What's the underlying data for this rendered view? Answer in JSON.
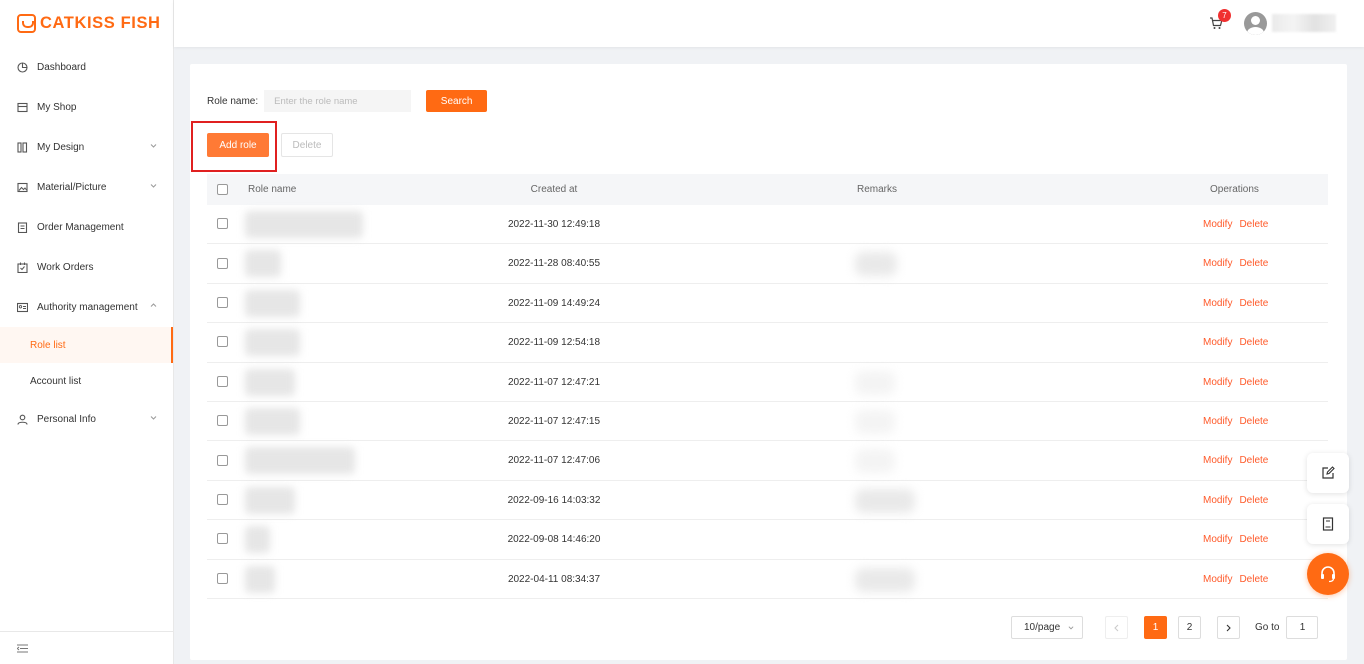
{
  "brand": {
    "name": "CATKISS FISH",
    "color": "#ff6a13"
  },
  "sidebar": {
    "items": [
      {
        "label": "Dashboard",
        "icon": "pie-chart-icon"
      },
      {
        "label": "My Shop",
        "icon": "shop-icon"
      },
      {
        "label": "My Design",
        "icon": "design-icon",
        "expandable": true
      },
      {
        "label": "Material/Picture",
        "icon": "picture-icon",
        "expandable": true
      },
      {
        "label": "Order Management",
        "icon": "clipboard-icon"
      },
      {
        "label": "Work Orders",
        "icon": "calendar-check-icon"
      },
      {
        "label": "Authority management",
        "icon": "id-card-icon",
        "expanded": true
      }
    ],
    "subitems": [
      {
        "label": "Role list",
        "active": true
      },
      {
        "label": "Account list"
      }
    ],
    "personal": {
      "label": "Personal Info",
      "icon": "user-icon"
    }
  },
  "header": {
    "cart_badge": "7"
  },
  "search": {
    "label": "Role name:",
    "placeholder": "Enter the role name",
    "button": "Search"
  },
  "actions": {
    "add": "Add role",
    "delete": "Delete"
  },
  "table": {
    "columns": [
      "Role name",
      "Created at",
      "Remarks",
      "Operations"
    ],
    "rows": [
      {
        "created_at": "2022-11-30 12:49:18"
      },
      {
        "created_at": "2022-11-28 08:40:55"
      },
      {
        "created_at": "2022-11-09 14:49:24"
      },
      {
        "created_at": "2022-11-09 12:54:18"
      },
      {
        "created_at": "2022-11-07 12:47:21"
      },
      {
        "created_at": "2022-11-07 12:47:15"
      },
      {
        "created_at": "2022-11-07 12:47:06"
      },
      {
        "created_at": "2022-09-16 14:03:32"
      },
      {
        "created_at": "2022-09-08 14:46:20"
      },
      {
        "created_at": "2022-04-11 08:34:37"
      }
    ],
    "op_modify": "Modify",
    "op_delete": "Delete"
  },
  "pagination": {
    "page_size": "10/page",
    "pages": [
      "1",
      "2"
    ],
    "current": "1",
    "goto_label": "Go to",
    "goto_value": "1"
  }
}
